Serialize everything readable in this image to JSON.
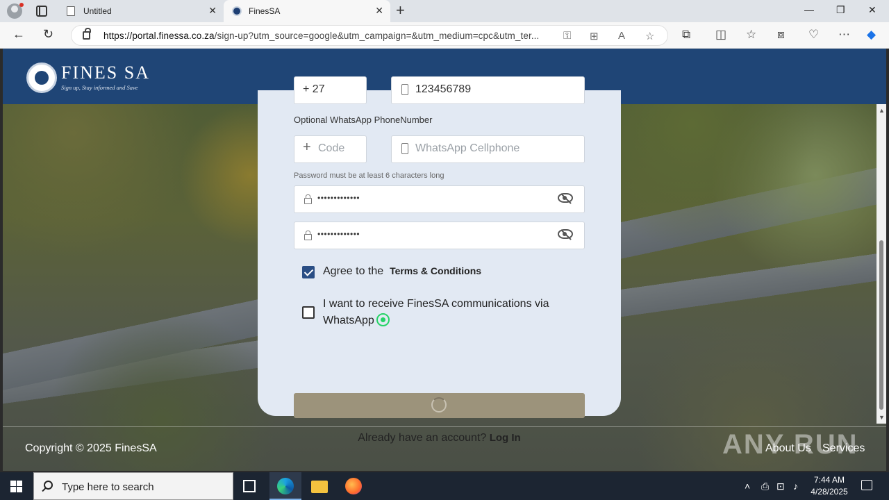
{
  "browser": {
    "tabs": [
      {
        "label": "Untitled"
      },
      {
        "label": "FinesSA"
      }
    ],
    "url_host": "https://portal.finessa.co.za",
    "url_path": "/sign-up?utm_source=google&utm_campaign=&utm_medium=cpc&utm_ter..."
  },
  "header": {
    "brand": "FINES SA",
    "tagline": "Sign up, Stay informed and Save"
  },
  "form": {
    "phone_code_value": "+ 27",
    "phone_value": "123456789",
    "whatsapp_label": "Optional WhatsApp PhoneNumber",
    "whatsapp_code_placeholder": "Code",
    "whatsapp_phone_placeholder": "WhatsApp Cellphone",
    "password_hint": "Password must be at least 6 characters long",
    "password_mask": "•••••••••••••",
    "confirm_mask": "•••••••••••••",
    "agree_text": "Agree to the",
    "terms_link": "Terms & Conditions",
    "agree_checked": true,
    "whatsapp_optin_text": "I want to receive FinesSA communications via WhatsApp",
    "whatsapp_optin_checked": false,
    "login_prompt": "Already have an account?",
    "login_link": "Log In"
  },
  "footer": {
    "copyright": "Copyright © 2025 FinesSA",
    "links": [
      "About Us",
      "Services"
    ],
    "watermark": "ANY RUN"
  },
  "taskbar": {
    "search_placeholder": "Type here to search",
    "time": "7:44 AM",
    "date": "4/28/2025"
  }
}
